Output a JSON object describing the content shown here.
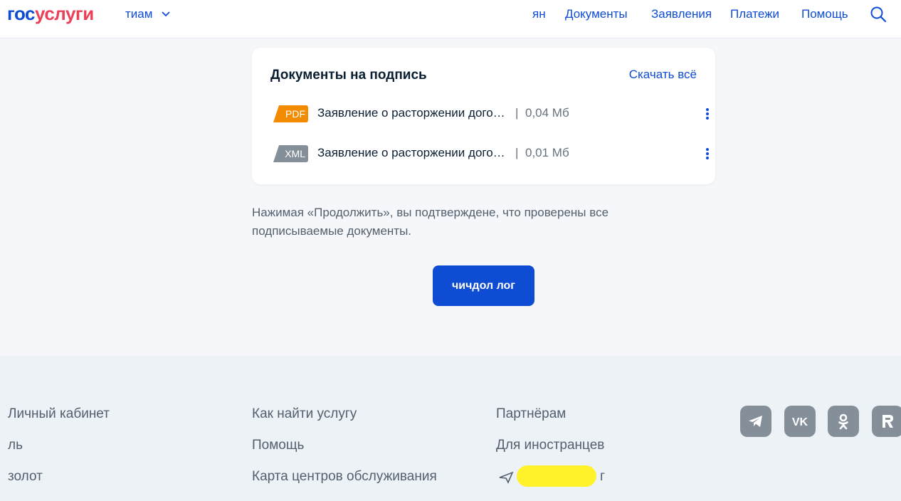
{
  "header": {
    "logo_part1": "гос",
    "logo_part2": "услуги",
    "region": "тиам",
    "nav": [
      {
        "label": "ян"
      },
      {
        "label": "Документы"
      },
      {
        "label": "Заявления"
      },
      {
        "label": "Платежи"
      },
      {
        "label": "Помощь"
      }
    ],
    "search_icon": "search-icon"
  },
  "card": {
    "title": "Документы на подпись",
    "download_all": "Скачать всё",
    "documents": [
      {
        "type": "PDF",
        "name": "Заявление о расторжении дого…",
        "separator": "|",
        "size": "0,04 Мб",
        "badge_color": "#f38b00"
      },
      {
        "type": "XML",
        "name": "Заявление о расторжении дого…",
        "separator": "|",
        "size": "0,01 Мб",
        "badge_color": "#858f99"
      }
    ]
  },
  "note": "Нажимая «Продолжить», вы подтверждене, что проверены все подписываемые документы.",
  "continue_button": "чичдол лог",
  "footer": {
    "col1": [
      "Личный кабинет",
      "ль",
      "золот"
    ],
    "col2": [
      "Как найти услугу",
      "Помощь",
      "Карта центров обслуживания"
    ],
    "col3": [
      "Партнёрам",
      "Для иностранцев",
      "г"
    ],
    "social": [
      "telegram-icon",
      "vk-icon",
      "odnoklassniki-icon",
      "rutube-icon"
    ]
  },
  "colors": {
    "accent": "#0d4cd3",
    "logo_red": "#ee3f58",
    "pdf_orange": "#f38b00",
    "xml_gray": "#858f99",
    "redaction": "#fff12a"
  }
}
